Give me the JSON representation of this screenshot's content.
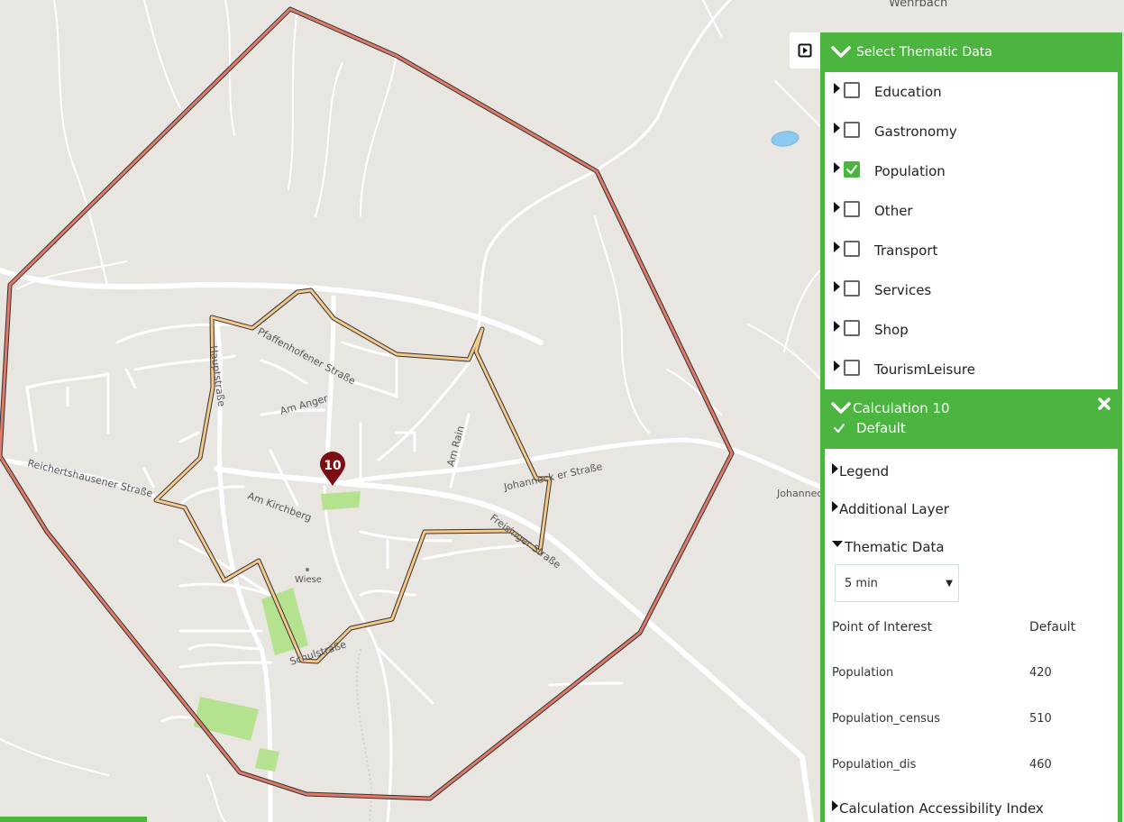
{
  "map": {
    "place_labels": {
      "top_village": "Wehrbach",
      "right_village": "Johannec"
    },
    "street_labels": {
      "pfaffenhofener": "Pfaffenhofener Straße",
      "hauptstrasse": "Hauptstraße",
      "am_anger": "Am Anger",
      "am_rain": "Am Rain",
      "reichertshausener": "Reichertshausener Straße",
      "am_kirchberg": "Am Kirchberg",
      "johanneck": "Johanneck er Straße",
      "freisinger": "Freisinger Straße",
      "wiese": "Wiese",
      "schulstrasse": "Schulstraße"
    },
    "marker_label": "10",
    "colors": {
      "outer_isochrone": "#e07a68",
      "inner_isochrone": "#f5c98c",
      "marker": "#7a0e12",
      "green_area": "#b5e28e",
      "water": "#8ccbf0"
    }
  },
  "sidebar": {
    "toggle_icon": "panel-collapse-icon",
    "thematic_header": "Select Thematic Data",
    "thematic_items": [
      {
        "label": "Education",
        "checked": false
      },
      {
        "label": "Gastronomy",
        "checked": false
      },
      {
        "label": "Population",
        "checked": true
      },
      {
        "label": "Other",
        "checked": false
      },
      {
        "label": "Transport",
        "checked": false
      },
      {
        "label": "Services",
        "checked": false
      },
      {
        "label": "Shop",
        "checked": false
      },
      {
        "label": "TourismLeisure",
        "checked": false
      }
    ],
    "accent": "#4cb53f"
  },
  "calculation": {
    "title": "Calculation 10",
    "scenario": "Default",
    "legend": "Legend",
    "additional_layer": "Additional Layer",
    "thematic_data": "Thematic Data",
    "time_select": "5 min",
    "table": {
      "headers": [
        "Point of Interest",
        "Default"
      ],
      "rows": [
        [
          "Population",
          "420"
        ],
        [
          "Population_census",
          "510"
        ],
        [
          "Population_dis",
          "460"
        ]
      ]
    },
    "accessibility_index": "Calculation Accessibility Index"
  }
}
